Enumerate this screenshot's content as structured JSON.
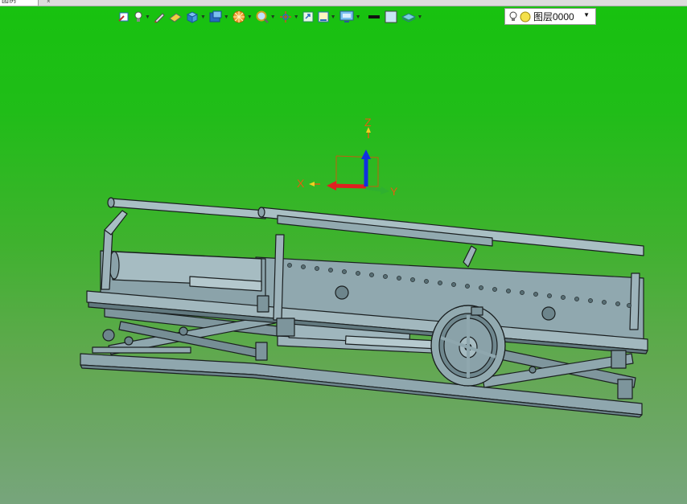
{
  "window": {
    "tab_label": "图例",
    "close_glyph": "×"
  },
  "toolbar": {
    "buttons": [
      {
        "icon": "sketch-icon"
      },
      {
        "icon": "light-bulb-icon"
      },
      {
        "icon": "pencil-icon"
      },
      {
        "icon": "eraser-icon"
      },
      {
        "icon": "box-icon"
      },
      {
        "icon": "shade-icon"
      },
      {
        "icon": "render-icon"
      },
      {
        "icon": "zoom-icon"
      },
      {
        "icon": "move-icon"
      },
      {
        "icon": "fit-icon"
      },
      {
        "icon": "view-icon"
      },
      {
        "icon": "display-icon"
      },
      {
        "icon": "line-style-icon"
      },
      {
        "icon": "color-icon"
      },
      {
        "icon": "layer-icon"
      }
    ],
    "layer_select": {
      "value": "图层0000"
    }
  },
  "triad": {
    "x_label": "X",
    "y_label": "Y",
    "z_label": "Z",
    "x_color": "#e02020",
    "y_color": "#2fb02f",
    "z_color": "#1030e0",
    "label_color": "#e06010"
  },
  "colors": {
    "model_fill": "#8fa7ae",
    "model_dark": "#5f7880",
    "model_edge": "#1a1f20",
    "bg_top": "#17c20f",
    "bg_bottom": "#77a57c"
  }
}
